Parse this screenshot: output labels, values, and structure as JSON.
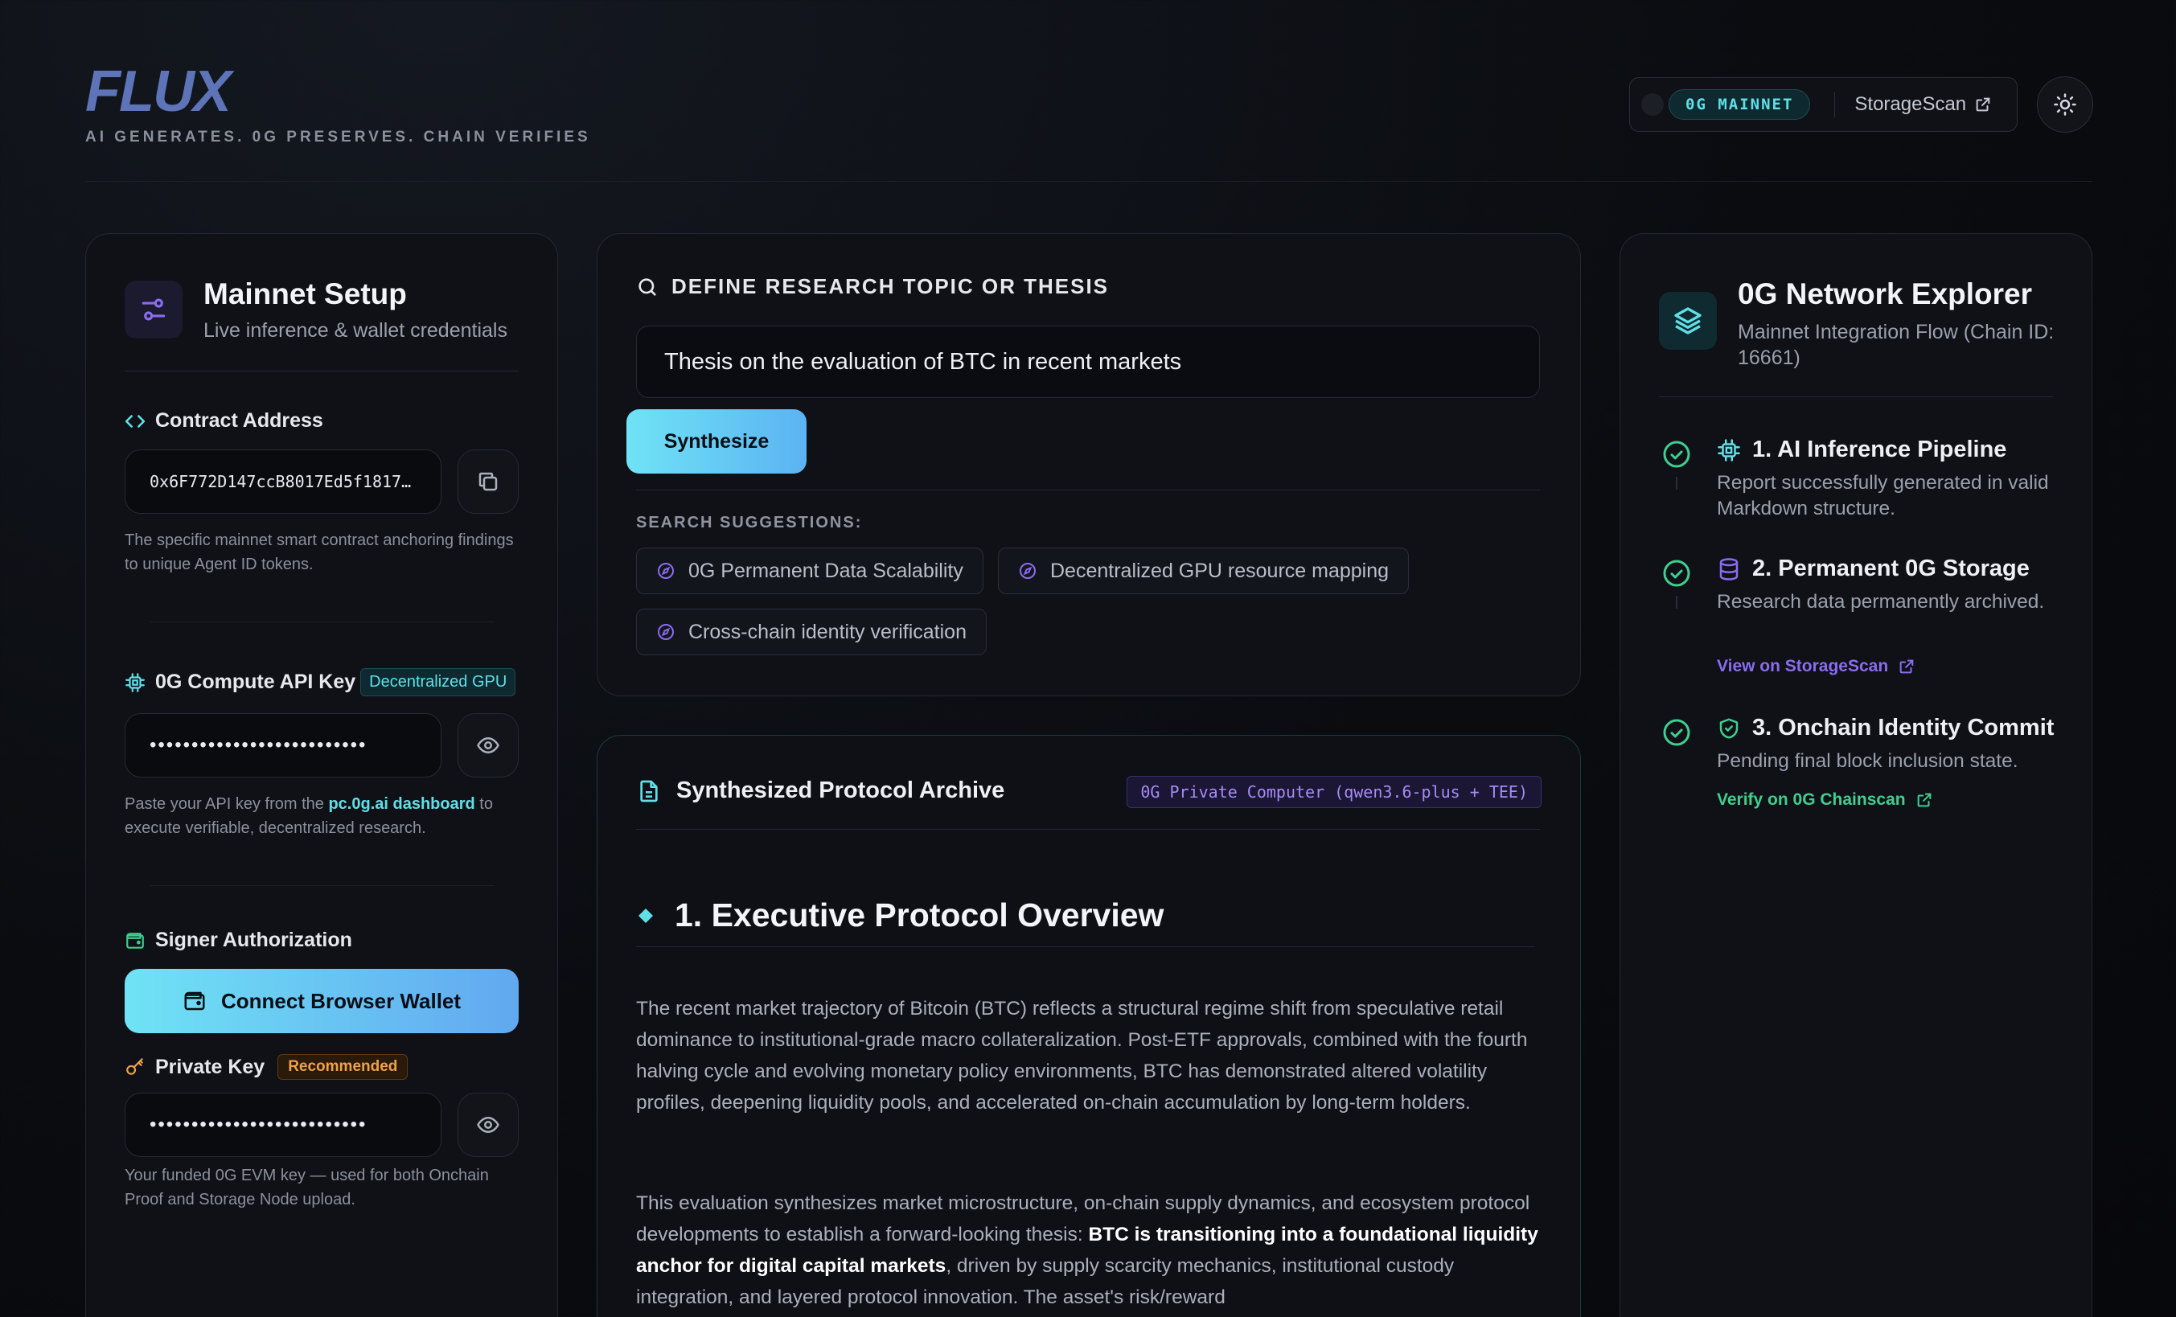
{
  "header": {
    "logo": "FLUX",
    "tagline": "AI GENERATES. 0G PRESERVES. CHAIN VERIFIES",
    "network_badge": "0G MAINNET",
    "storagescan_label": "StorageScan"
  },
  "setup": {
    "title": "Mainnet Setup",
    "subtitle": "Live inference & wallet credentials",
    "contract_label": "Contract Address",
    "contract_value": "0x6F772D147ccB8017Ed5f1817…",
    "contract_help": "The specific mainnet smart contract anchoring findings to unique Agent ID tokens.",
    "api_label": "0G Compute API Key",
    "api_tag": "Decentralized GPU",
    "api_value": "••••••••••••••••••••••••••",
    "api_help_prefix": "Paste your API key from the ",
    "api_help_link": "pc.0g.ai dashboard",
    "api_help_suffix": " to execute verifiable, decentralized research.",
    "signer_label": "Signer Authorization",
    "connect_label": "Connect Browser Wallet",
    "pk_label": "Private Key",
    "pk_tag": "Recommended",
    "pk_value": "••••••••••••••••••••••••••",
    "pk_help": "Your funded 0G EVM key — used for both Onchain Proof and Storage Node upload."
  },
  "research": {
    "section_label": "DEFINE RESEARCH TOPIC OR THESIS",
    "topic_value": "Thesis on the evaluation of BTC in recent markets",
    "synthesize_label": "Synthesize",
    "suggestions_label": "SEARCH SUGGESTIONS:",
    "suggestions": [
      "0G Permanent Data Scalability",
      "Decentralized GPU resource mapping",
      "Cross-chain identity verification"
    ]
  },
  "archive": {
    "title": "Synthesized Protocol Archive",
    "engine_tag": "0G Private Computer (qwen3.6-plus + TEE)",
    "heading": "1. Executive Protocol Overview",
    "para1": "The recent market trajectory of Bitcoin (BTC) reflects a structural regime shift from speculative retail dominance to institutional-grade macro collateralization. Post-ETF approvals, combined with the fourth halving cycle and evolving monetary policy environments, BTC has demonstrated altered volatility profiles, deepening liquidity pools, and accelerated on-chain accumulation by long-term holders.",
    "para2_prefix": "This evaluation synthesizes market microstructure, on-chain supply dynamics, and ecosystem protocol developments to establish a forward-looking thesis: ",
    "para2_bold": "BTC is transitioning into a foundational liquidity anchor for digital capital markets",
    "para2_suffix": ", driven by supply scarcity mechanics, institutional custody integration, and layered protocol innovation. The asset's risk/reward"
  },
  "explorer": {
    "title": "0G Network Explorer",
    "subtitle": "Mainnet Integration Flow (Chain ID: 16661)",
    "steps": [
      {
        "title": "1. AI Inference Pipeline",
        "desc": "Report successfully generated in valid Markdown structure.",
        "link": ""
      },
      {
        "title": "2. Permanent 0G Storage",
        "desc": "Research data permanently archived.",
        "link": "View on StorageScan"
      },
      {
        "title": "3. Onchain Identity Commit",
        "desc": "Pending final block inclusion state.",
        "link": "Verify on 0G Chainscan"
      }
    ]
  },
  "colors": {
    "accent_cyan": "#5fe0e8",
    "accent_purple": "#8b6cf0",
    "accent_green": "#3fcf8e",
    "accent_amber": "#f0a14a"
  }
}
